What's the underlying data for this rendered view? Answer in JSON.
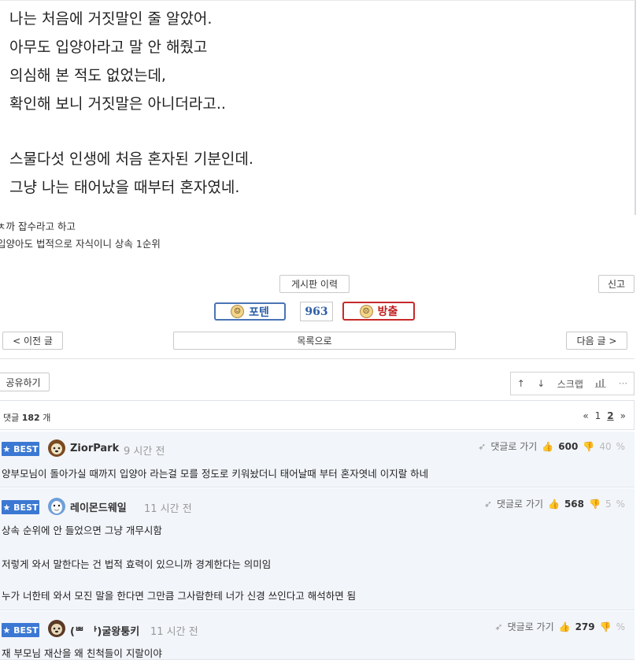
{
  "story": {
    "lines": [
      "나는 처음에 거짓말인 줄 알았어.",
      "아무도 입양아라고 말 안 해줬고",
      "의심해 본 적도 없었는데,",
      "확인해 보니 거짓말은 아니더라고..",
      "스물다섯 인생에 처음 혼자된 기분인데.",
      "그냥 나는 태어났을 때부터 혼자였네."
    ]
  },
  "notes": [
    "ㅊ까 잡수라고 하고",
    "입양아도 법적으로 자식이니 상속 1순위"
  ],
  "actions": {
    "history": "게시판 이력",
    "report": "신고",
    "upvote": "포텐",
    "vote_count": "963",
    "downvote": "방출",
    "prev": "< 이전 글",
    "list": "목록으로",
    "next": "다음 글 >",
    "share": "공유하기",
    "scrap": "스크랩"
  },
  "comments_header": {
    "label_prefix": "댓글",
    "count": "182",
    "label_suffix": "개",
    "pager_prev": "«",
    "page1": "1",
    "page2": "2",
    "pager_next": "»"
  },
  "comments": [
    {
      "badge": "★ BEST",
      "author": "ZiorPark",
      "time": "9 시간 전",
      "goto": "댓글로 가기",
      "likes": "600",
      "dislikes": "40",
      "text": [
        "양부모님이 돌아가실 때까지 입양아 라는걸 모를 정도로 키워놨더니 태어날때 부터 혼자엿네 이지랄 하네"
      ]
    },
    {
      "badge": "★ BEST",
      "author": "레이몬드웨일",
      "time": "11 시간 전",
      "goto": "댓글로 가기",
      "likes": "568",
      "dislikes": "5",
      "text": [
        "상속 순위에 안 들었으면 그냥 개무시함",
        "저렇게 와서 말한다는 건 법적 효력이 있으니까 경계한다는 의미임",
        "누가 너한테 와서 모진 말을 한다면 그만큼 그사람한테 너가 신경 쓰인다고 해석하면 됨"
      ]
    },
    {
      "badge": "★ BEST",
      "author": "(ᄈ ᅡ)굴왕퉁키",
      "time": "11 시간 전",
      "goto": "댓글로 가기",
      "likes": "279",
      "dislikes": "",
      "text": [
        "재 부모님 재산을 왜 친척들이 지랄이야"
      ]
    }
  ],
  "colors": {
    "best_badge": "#3b78d3",
    "upvote": "#2e5fa8",
    "downvote": "#c12020",
    "comment_bg": "#f2f5fa"
  }
}
